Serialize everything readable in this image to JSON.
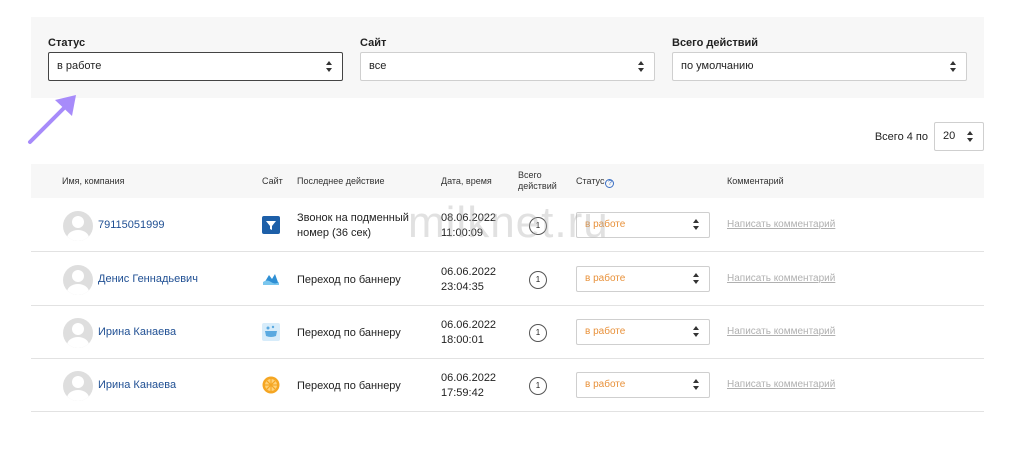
{
  "filters": {
    "status": {
      "label": "Статус",
      "value": "в работе"
    },
    "site": {
      "label": "Сайт",
      "value": "все"
    },
    "actions": {
      "label": "Всего действий",
      "value": "по умолчанию"
    }
  },
  "pager": {
    "text": "Всего 4 по",
    "per_page": "20"
  },
  "columns": {
    "name": "Имя, компания",
    "site": "Сайт",
    "last_action": "Последнее действие",
    "datetime": "Дата, время",
    "total_actions_1": "Всего",
    "total_actions_2": "действий",
    "status": "Статус",
    "comment": "Комментарий"
  },
  "rows": [
    {
      "name": "79115051999",
      "site_icon": "funnel-icon",
      "action_1": "Звонок на подменный",
      "action_2": "номер (36 сек)",
      "date": "08.06.2022",
      "time": "11:00:09",
      "count": "1",
      "status": "в работе",
      "comment": "Написать комментарий"
    },
    {
      "name": "Денис Геннадьевич",
      "site_icon": "waves-icon",
      "action_1": "Переход по баннеру",
      "action_2": "",
      "date": "06.06.2022",
      "time": "23:04:35",
      "count": "1",
      "status": "в работе",
      "comment": "Написать комментарий"
    },
    {
      "name": "Ирина Канаева",
      "site_icon": "bath-icon",
      "action_1": "Переход по баннеру",
      "action_2": "",
      "date": "06.06.2022",
      "time": "18:00:01",
      "count": "1",
      "status": "в работе",
      "comment": "Написать комментарий"
    },
    {
      "name": "Ирина Канаева",
      "site_icon": "orange-slice-icon",
      "action_1": "Переход по баннеру",
      "action_2": "",
      "date": "06.06.2022",
      "time": "17:59:42",
      "count": "1",
      "status": "в работе",
      "comment": "Написать комментарий"
    }
  ],
  "watermark": "milknet.ru",
  "colors": {
    "link": "#1f4f93",
    "status": "#e8913a",
    "arrow": "#a78bfa",
    "panel": "#f7f7f7"
  }
}
